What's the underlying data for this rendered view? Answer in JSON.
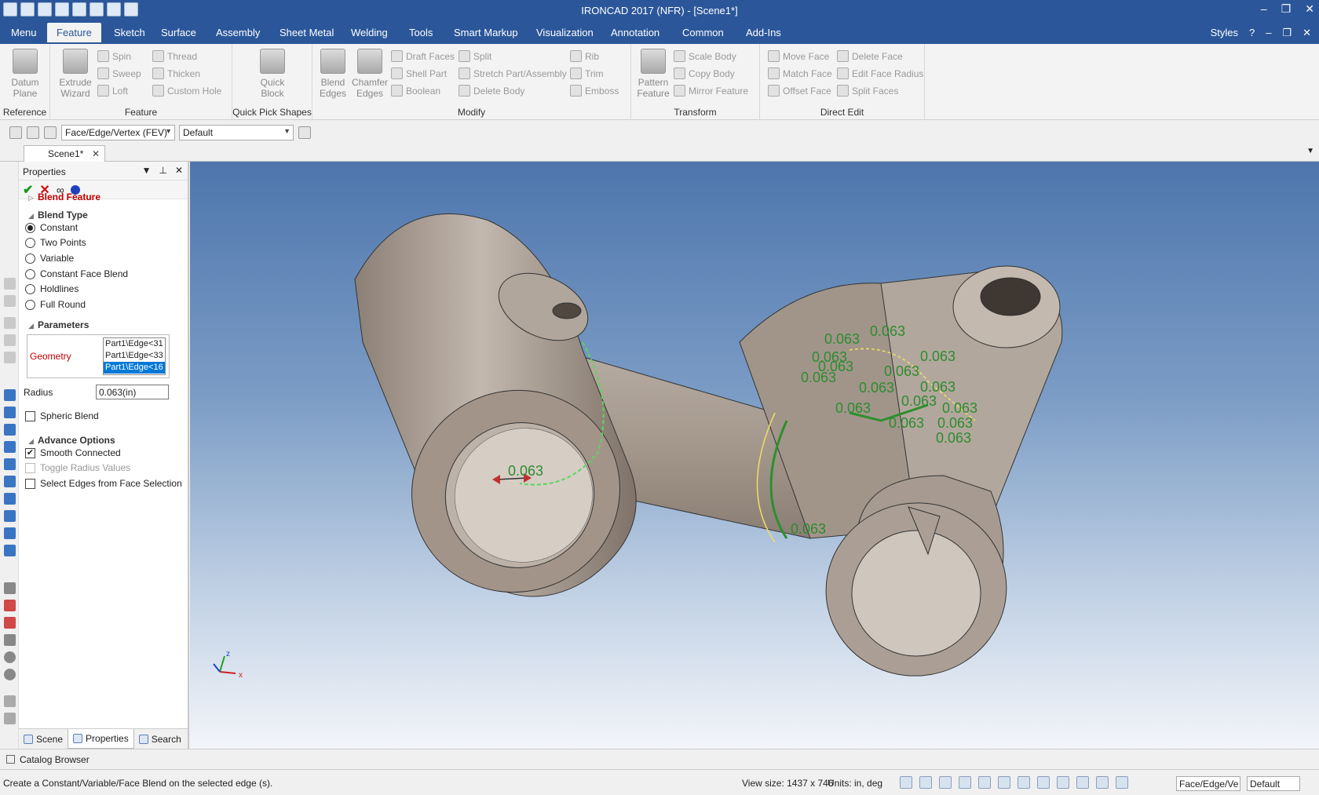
{
  "window": {
    "title": "IRONCAD 2017 (NFR) - [Scene1*]"
  },
  "ribbon_tabs": [
    "Menu",
    "Feature",
    "Sketch",
    "Surface",
    "Assembly",
    "Sheet Metal",
    "Welding",
    "Tools",
    "Smart Markup",
    "Visualization",
    "Annotation",
    "Common",
    "Add-Ins"
  ],
  "active_tab": "Feature",
  "styles_label": "Styles",
  "groups": {
    "reference": {
      "label": "Reference",
      "datum_plane": "Datum\nPlane"
    },
    "feature": {
      "label": "Feature",
      "extrude_wizard": "Extrude\nWizard",
      "spin": "Spin",
      "sweep": "Sweep",
      "loft": "Loft",
      "thread": "Thread",
      "thicken": "Thicken",
      "custom_hole": "Custom Hole"
    },
    "quick_pick": {
      "label": "Quick Pick Shapes",
      "quick_block": "Quick\nBlock"
    },
    "modify": {
      "label": "Modify",
      "blend_edges": "Blend\nEdges",
      "chamfer_edges": "Chamfer\nEdges",
      "draft_faces": "Draft Faces",
      "shell_part": "Shell Part",
      "boolean": "Boolean",
      "split": "Split",
      "stretch": "Stretch Part/Assembly",
      "delete_body": "Delete Body",
      "rib": "Rib",
      "trim": "Trim",
      "emboss": "Emboss"
    },
    "transform": {
      "label": "Transform",
      "pattern_feature": "Pattern\nFeature",
      "scale_body": "Scale Body",
      "copy_body": "Copy Body",
      "mirror_feature": "Mirror Feature"
    },
    "direct_edit": {
      "label": "Direct Edit",
      "move_face": "Move Face",
      "match_face": "Match Face",
      "offset_face": "Offset Face",
      "delete_face": "Delete Face",
      "edit_face_radius": "Edit Face Radius",
      "split_faces": "Split Faces"
    }
  },
  "selection_toolbar": {
    "filter": "Face/Edge/Vertex (FEV)",
    "style": "Default"
  },
  "document_tab": "Scene1*",
  "properties": {
    "title": "Properties",
    "feature_title": "Blend Feature",
    "blend_type_header": "Blend Type",
    "blend_types": [
      {
        "label": "Constant",
        "selected": true
      },
      {
        "label": "Two Points",
        "selected": false
      },
      {
        "label": "Variable",
        "selected": false
      },
      {
        "label": "Constant Face Blend",
        "selected": false
      },
      {
        "label": "Holdlines",
        "selected": false
      },
      {
        "label": "Full Round",
        "selected": false
      }
    ],
    "parameters_header": "Parameters",
    "geometry_label": "Geometry",
    "geometry_items": [
      "Part1\\Edge<31",
      "Part1\\Edge<33",
      "Part1\\Edge<16"
    ],
    "radius_label": "Radius",
    "radius_value": "0.063(in)",
    "spheric_blend": "Spheric Blend",
    "advance_header": "Advance Options",
    "smooth_connected": "Smooth Connected",
    "toggle_radius": "Toggle Radius Values",
    "select_edges": "Select Edges from Face Selection",
    "bottom_tabs": [
      "Scene",
      "Properties",
      "Search"
    ]
  },
  "viewport": {
    "blend_radius_label": "0.063",
    "axis_x": "x",
    "axis_z": "z"
  },
  "catalog_browser": "Catalog Browser",
  "status": {
    "message": "Create a Constant/Variable/Face Blend on the selected edge (s).",
    "view_size": "View size: 1437 x  746",
    "units": "Units: in, deg",
    "filter_short": "Face/Edge/Ve",
    "style_short": "Default"
  },
  "colors": {
    "title_bar": "#2b579a",
    "accent_red": "#c00000",
    "dimension_green": "#2e8b2e",
    "part": "#a3968b"
  }
}
